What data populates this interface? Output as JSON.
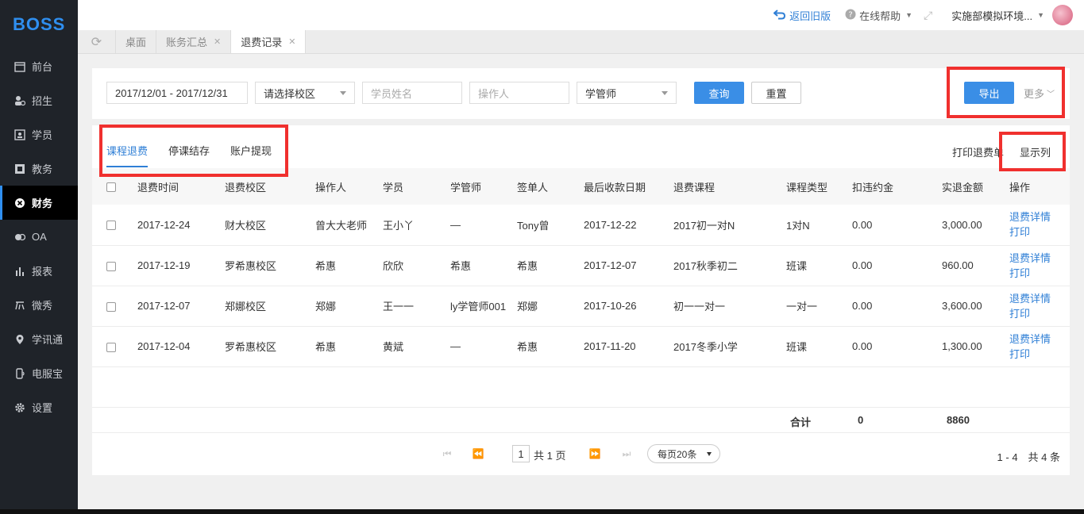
{
  "app": {
    "logo": "BOSS"
  },
  "sidebar": {
    "items": [
      {
        "label": "前台",
        "icon": "calendar-icon"
      },
      {
        "label": "招生",
        "icon": "recruit-icon"
      },
      {
        "label": "学员",
        "icon": "student-icon"
      },
      {
        "label": "教务",
        "icon": "teaching-icon"
      },
      {
        "label": "财务",
        "icon": "finance-icon",
        "active": true
      },
      {
        "label": "OA",
        "icon": "oa-icon"
      },
      {
        "label": "报表",
        "icon": "report-icon"
      },
      {
        "label": "微秀",
        "icon": "weixiu-icon"
      },
      {
        "label": "学讯通",
        "icon": "location-icon"
      },
      {
        "label": "电服宝",
        "icon": "phone-service-icon"
      },
      {
        "label": "设置",
        "icon": "gear-icon"
      }
    ]
  },
  "header": {
    "back_old": "返回旧版",
    "help": "在线帮助",
    "user": "实施部模拟环境..."
  },
  "tabs": [
    {
      "label": "桌面"
    },
    {
      "label": "账务汇总"
    },
    {
      "label": "退费记录",
      "active": true
    }
  ],
  "filters": {
    "date_range": "2017/12/01 - 2017/12/31",
    "campus": "请选择校区",
    "student_placeholder": "学员姓名",
    "operator_placeholder": "操作人",
    "role": "学管师",
    "query": "查询",
    "reset": "重置",
    "export": "导出",
    "more": "更多"
  },
  "subtabs": [
    {
      "label": "课程退费",
      "active": true
    },
    {
      "label": "停课结存"
    },
    {
      "label": "账户提现"
    }
  ],
  "actions": {
    "print_slips": "打印退费单",
    "show_columns": "显示列"
  },
  "table": {
    "columns": [
      "退费时间",
      "退费校区",
      "操作人",
      "学员",
      "学管师",
      "签单人",
      "最后收款日期",
      "退费课程",
      "课程类型",
      "扣违约金",
      "实退金额",
      "操作"
    ],
    "rows": [
      [
        "2017-12-24",
        "财大校区",
        "曾大大老师",
        "王小丫",
        "—",
        "Tony曾",
        "2017-12-22",
        "2017初一对N",
        "1对N",
        "0.00",
        "3,000.00"
      ],
      [
        "2017-12-19",
        "罗希惠校区",
        "希惠",
        "欣欣",
        "希惠",
        "希惠",
        "2017-12-07",
        "2017秋季初二",
        "班课",
        "0.00",
        "960.00"
      ],
      [
        "2017-12-07",
        "郑娜校区",
        "郑娜",
        "王一一",
        "ly学管师001",
        "郑娜",
        "2017-10-26",
        "初一一对一",
        "一对一",
        "0.00",
        "3,600.00"
      ],
      [
        "2017-12-04",
        "罗希惠校区",
        "希惠",
        "黄斌",
        "—",
        "希惠",
        "2017-11-20",
        "2017冬季小学",
        "班课",
        "0.00",
        "1,300.00"
      ]
    ],
    "op_detail": "退费详情",
    "op_print": "打印",
    "summary": {
      "label": "合计",
      "penalty": "0",
      "refund": "8860"
    }
  },
  "pagination": {
    "page": "1",
    "total_pages": "共 1 页",
    "page_size": "每页20条",
    "info": "1 - 4　共 4 条"
  },
  "colors": {
    "accent": "#2f7fd6",
    "highlight_box": "#f0302e",
    "sidebar_bg": "#1f2329"
  }
}
